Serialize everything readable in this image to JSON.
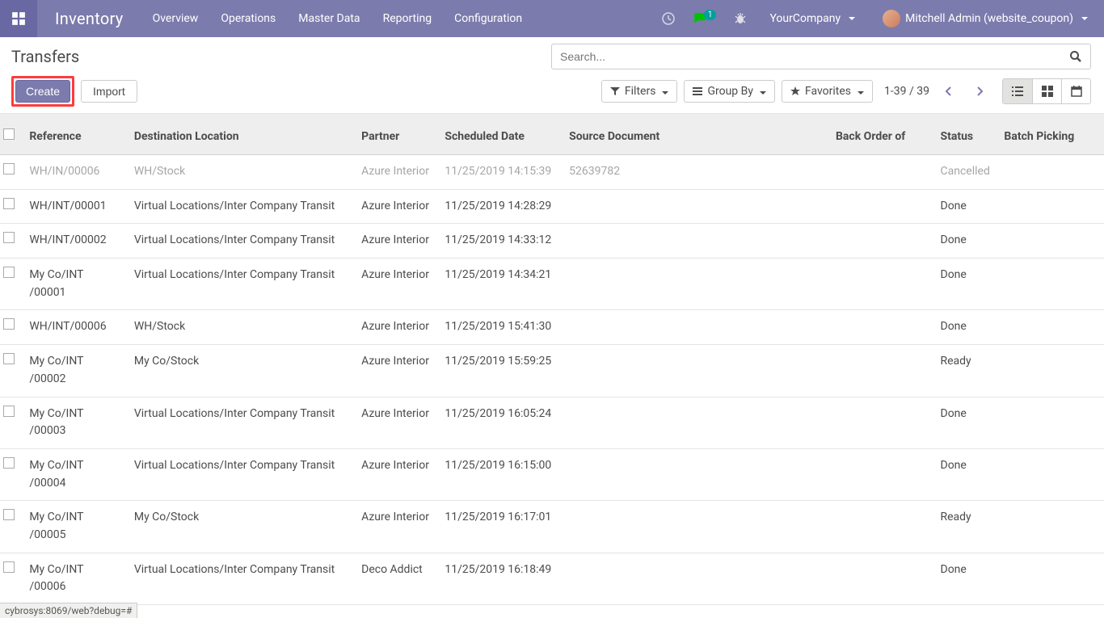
{
  "nav": {
    "title": "Inventory",
    "items": [
      "Overview",
      "Operations",
      "Master Data",
      "Reporting",
      "Configuration"
    ],
    "chat_badge": "1",
    "company": "YourCompany",
    "user": "Mitchell Admin (website_coupon)"
  },
  "breadcrumb": "Transfers",
  "search_placeholder": "Search...",
  "buttons": {
    "create": "Create",
    "import": "Import",
    "filters": "Filters",
    "group_by": "Group By",
    "favorites": "Favorites"
  },
  "pager": {
    "range": "1-39",
    "sep": " / ",
    "total": "39"
  },
  "table": {
    "headers": {
      "reference": "Reference",
      "destination": "Destination Location",
      "partner": "Partner",
      "scheduled": "Scheduled Date",
      "source": "Source Document",
      "backorder": "Back Order of",
      "status": "Status",
      "batch": "Batch Picking"
    },
    "rows": [
      {
        "ref": "WH/IN/00006",
        "dest": "WH/Stock",
        "partner": "Azure Interior",
        "date": "11/25/2019 14:15:39",
        "src": "52639782",
        "status": "Cancelled",
        "cancelled": true
      },
      {
        "ref": "WH/INT/00001",
        "dest": "Virtual Locations/Inter Company Transit",
        "partner": "Azure Interior",
        "date": "11/25/2019 14:28:29",
        "src": "",
        "status": "Done"
      },
      {
        "ref": "WH/INT/00002",
        "dest": "Virtual Locations/Inter Company Transit",
        "partner": "Azure Interior",
        "date": "11/25/2019 14:33:12",
        "src": "",
        "status": "Done"
      },
      {
        "ref": "My Co/INT /00001",
        "dest": "Virtual Locations/Inter Company Transit",
        "partner": "Azure Interior",
        "date": "11/25/2019 14:34:21",
        "src": "",
        "status": "Done"
      },
      {
        "ref": "WH/INT/00006",
        "dest": "WH/Stock",
        "partner": "Azure Interior",
        "date": "11/25/2019 15:41:30",
        "src": "",
        "status": "Done"
      },
      {
        "ref": "My Co/INT /00002",
        "dest": "My Co/Stock",
        "partner": "Azure Interior",
        "date": "11/25/2019 15:59:25",
        "src": "",
        "status": "Ready"
      },
      {
        "ref": "My Co/INT /00003",
        "dest": "Virtual Locations/Inter Company Transit",
        "partner": "Azure Interior",
        "date": "11/25/2019 16:05:24",
        "src": "",
        "status": "Done"
      },
      {
        "ref": "My Co/INT /00004",
        "dest": "Virtual Locations/Inter Company Transit",
        "partner": "Azure Interior",
        "date": "11/25/2019 16:15:00",
        "src": "",
        "status": "Done"
      },
      {
        "ref": "My Co/INT /00005",
        "dest": "My Co/Stock",
        "partner": "Azure Interior",
        "date": "11/25/2019 16:17:01",
        "src": "",
        "status": "Ready"
      },
      {
        "ref": "My Co/INT /00006",
        "dest": "Virtual Locations/Inter Company Transit",
        "partner": "Deco Addict",
        "date": "11/25/2019 16:18:49",
        "src": "",
        "status": "Done"
      }
    ]
  },
  "status_url": "cybrosys:8069/web?debug=#"
}
